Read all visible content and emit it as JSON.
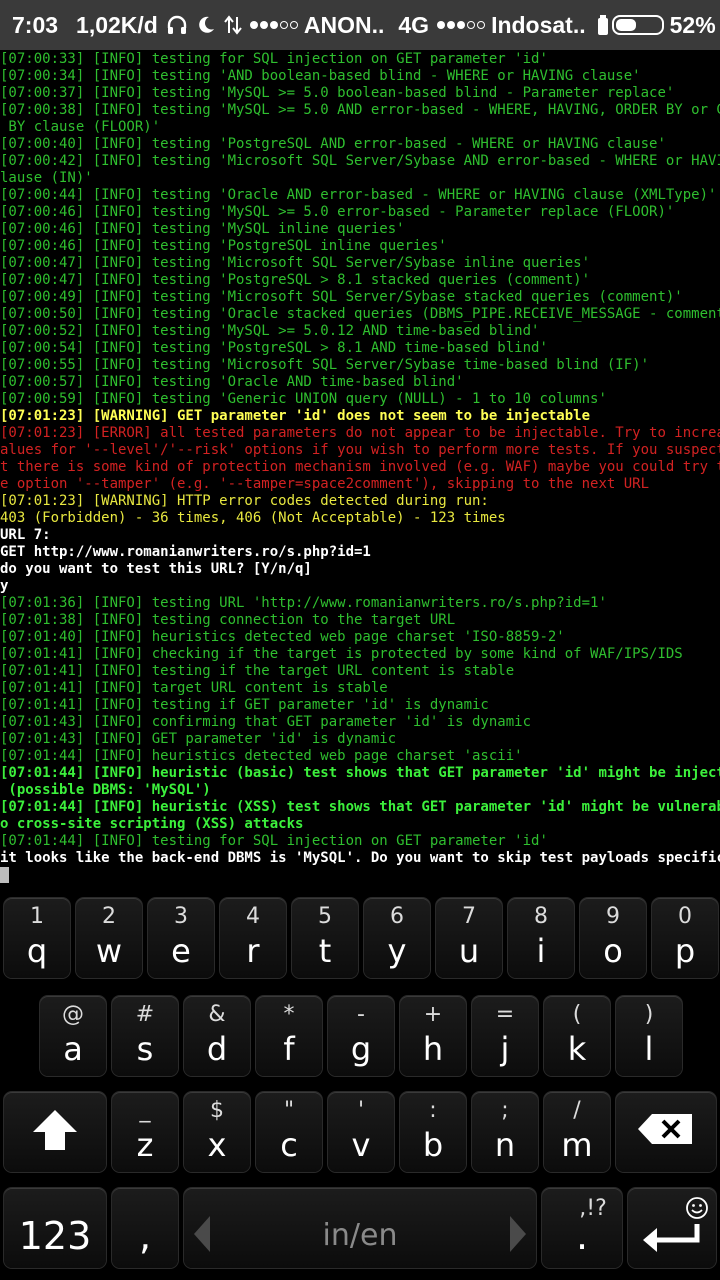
{
  "status_bar": {
    "time": "7:03",
    "speed": "1,02K/d",
    "carrier1": "ANON..",
    "network": "4G",
    "carrier2": "Indosat..",
    "battery_percent": "52%",
    "battery_level": 0.52,
    "icons": [
      "headphones-icon",
      "moon-icon",
      "data-transfer-icon",
      "signal-icon",
      "signal-icon",
      "charging-icon",
      "battery-icon"
    ]
  },
  "terminal": {
    "lines": [
      {
        "text": "[07:00:33] [INFO] testing for SQL injection on GET parameter 'id'",
        "style": "green"
      },
      {
        "text": "[07:00:34] [INFO] testing 'AND boolean-based blind - WHERE or HAVING clause'",
        "style": "green"
      },
      {
        "text": "[07:00:37] [INFO] testing 'MySQL >= 5.0 boolean-based blind - Parameter replace'",
        "style": "green"
      },
      {
        "text": "[07:00:38] [INFO] testing 'MySQL >= 5.0 AND error-based - WHERE, HAVING, ORDER BY or GROUP",
        "style": "green"
      },
      {
        "text": " BY clause (FLOOR)'",
        "style": "green"
      },
      {
        "text": "[07:00:40] [INFO] testing 'PostgreSQL AND error-based - WHERE or HAVING clause'",
        "style": "green"
      },
      {
        "text": "[07:00:42] [INFO] testing 'Microsoft SQL Server/Sybase AND error-based - WHERE or HAVING c",
        "style": "green"
      },
      {
        "text": "lause (IN)'",
        "style": "green"
      },
      {
        "text": "[07:00:44] [INFO] testing 'Oracle AND error-based - WHERE or HAVING clause (XMLType)'",
        "style": "green"
      },
      {
        "text": "[07:00:46] [INFO] testing 'MySQL >= 5.0 error-based - Parameter replace (FLOOR)'",
        "style": "green"
      },
      {
        "text": "[07:00:46] [INFO] testing 'MySQL inline queries'",
        "style": "green"
      },
      {
        "text": "[07:00:46] [INFO] testing 'PostgreSQL inline queries'",
        "style": "green"
      },
      {
        "text": "[07:00:47] [INFO] testing 'Microsoft SQL Server/Sybase inline queries'",
        "style": "green"
      },
      {
        "text": "[07:00:47] [INFO] testing 'PostgreSQL > 8.1 stacked queries (comment)'",
        "style": "green"
      },
      {
        "text": "[07:00:49] [INFO] testing 'Microsoft SQL Server/Sybase stacked queries (comment)'",
        "style": "green"
      },
      {
        "text": "[07:00:50] [INFO] testing 'Oracle stacked queries (DBMS_PIPE.RECEIVE_MESSAGE - comment)'",
        "style": "green"
      },
      {
        "text": "[07:00:52] [INFO] testing 'MySQL >= 5.0.12 AND time-based blind'",
        "style": "green"
      },
      {
        "text": "[07:00:54] [INFO] testing 'PostgreSQL > 8.1 AND time-based blind'",
        "style": "green"
      },
      {
        "text": "[07:00:55] [INFO] testing 'Microsoft SQL Server/Sybase time-based blind (IF)'",
        "style": "green"
      },
      {
        "text": "[07:00:57] [INFO] testing 'Oracle AND time-based blind'",
        "style": "green"
      },
      {
        "text": "[07:00:59] [INFO] testing 'Generic UNION query (NULL) - 1 to 10 columns'",
        "style": "green"
      },
      {
        "text": "[07:01:23] [WARNING] GET parameter 'id' does not seem to be injectable",
        "style": "byellow"
      },
      {
        "text": "[07:01:23] [ERROR] all tested parameters do not appear to be injectable. Try to increase v",
        "style": "red"
      },
      {
        "text": "alues for '--level'/'--risk' options if you wish to perform more tests. If you suspect tha",
        "style": "red"
      },
      {
        "text": "t there is some kind of protection mechanism involved (e.g. WAF) maybe you could try to us",
        "style": "red"
      },
      {
        "text": "e option '--tamper' (e.g. '--tamper=space2comment'), skipping to the next URL",
        "style": "red"
      },
      {
        "text": "[07:01:23] [WARNING] HTTP error codes detected during run:",
        "style": "yellow"
      },
      {
        "text": "403 (Forbidden) - 36 times, 406 (Not Acceptable) - 123 times",
        "style": "yellow"
      },
      {
        "text": "URL 7:",
        "style": "white"
      },
      {
        "text": "GET http://www.romanianwriters.ro/s.php?id=1",
        "style": "white"
      },
      {
        "text": "do you want to test this URL? [Y/n/q]",
        "style": "white"
      },
      {
        "text": "y",
        "style": "white"
      },
      {
        "text": "[07:01:36] [INFO] testing URL 'http://www.romanianwriters.ro/s.php?id=1'",
        "style": "green"
      },
      {
        "text": "[07:01:38] [INFO] testing connection to the target URL",
        "style": "green"
      },
      {
        "text": "[07:01:40] [INFO] heuristics detected web page charset 'ISO-8859-2'",
        "style": "green"
      },
      {
        "text": "[07:01:41] [INFO] checking if the target is protected by some kind of WAF/IPS/IDS",
        "style": "green"
      },
      {
        "text": "[07:01:41] [INFO] testing if the target URL content is stable",
        "style": "green"
      },
      {
        "text": "[07:01:41] [INFO] target URL content is stable",
        "style": "green"
      },
      {
        "text": "[07:01:41] [INFO] testing if GET parameter 'id' is dynamic",
        "style": "green"
      },
      {
        "text": "[07:01:43] [INFO] confirming that GET parameter 'id' is dynamic",
        "style": "green"
      },
      {
        "text": "[07:01:43] [INFO] GET parameter 'id' is dynamic",
        "style": "green"
      },
      {
        "text": "[07:01:44] [INFO] heuristics detected web page charset 'ascii'",
        "style": "green"
      },
      {
        "text": "[07:01:44] [INFO] heuristic (basic) test shows that GET parameter 'id' might be injectable",
        "style": "bgreen"
      },
      {
        "text": " (possible DBMS: 'MySQL')",
        "style": "bgreen"
      },
      {
        "text": "[07:01:44] [INFO] heuristic (XSS) test shows that GET parameter 'id' might be vulnerable t",
        "style": "bgreen"
      },
      {
        "text": "o cross-site scripting (XSS) attacks",
        "style": "bgreen"
      },
      {
        "text": "[07:01:44] [INFO] testing for SQL injection on GET parameter 'id'",
        "style": "green"
      },
      {
        "text": "it looks like the back-end DBMS is 'MySQL'. Do you want to skip test payloads specific for",
        "style": "white"
      }
    ]
  },
  "keyboard": {
    "row1": [
      {
        "hint": "1",
        "label": "q"
      },
      {
        "hint": "2",
        "label": "w"
      },
      {
        "hint": "3",
        "label": "e"
      },
      {
        "hint": "4",
        "label": "r"
      },
      {
        "hint": "5",
        "label": "t"
      },
      {
        "hint": "6",
        "label": "y"
      },
      {
        "hint": "7",
        "label": "u"
      },
      {
        "hint": "8",
        "label": "i"
      },
      {
        "hint": "9",
        "label": "o"
      },
      {
        "hint": "0",
        "label": "p"
      }
    ],
    "row2": [
      {
        "hint": "@",
        "label": "a"
      },
      {
        "hint": "#",
        "label": "s"
      },
      {
        "hint": "&",
        "label": "d"
      },
      {
        "hint": "*",
        "label": "f"
      },
      {
        "hint": "-",
        "label": "g"
      },
      {
        "hint": "+",
        "label": "h"
      },
      {
        "hint": "=",
        "label": "j"
      },
      {
        "hint": "(",
        "label": "k"
      },
      {
        "hint": ")",
        "label": "l"
      }
    ],
    "row3": [
      {
        "hint": "_",
        "label": "z"
      },
      {
        "hint": "$",
        "label": "x"
      },
      {
        "hint": "\"",
        "label": "c"
      },
      {
        "hint": "'",
        "label": "v"
      },
      {
        "hint": ":",
        "label": "b"
      },
      {
        "hint": ";",
        "label": "n"
      },
      {
        "hint": "/",
        "label": "m"
      }
    ],
    "shift_icon": "shift-arrow-icon",
    "backspace_icon": "backspace-icon",
    "numbers_label": "123",
    "comma_label": ",",
    "language_label": "in/en",
    "period_label": ".",
    "period_hint": ",!?",
    "emoji_icon": "emoji-icon",
    "enter_icon": "enter-icon"
  }
}
